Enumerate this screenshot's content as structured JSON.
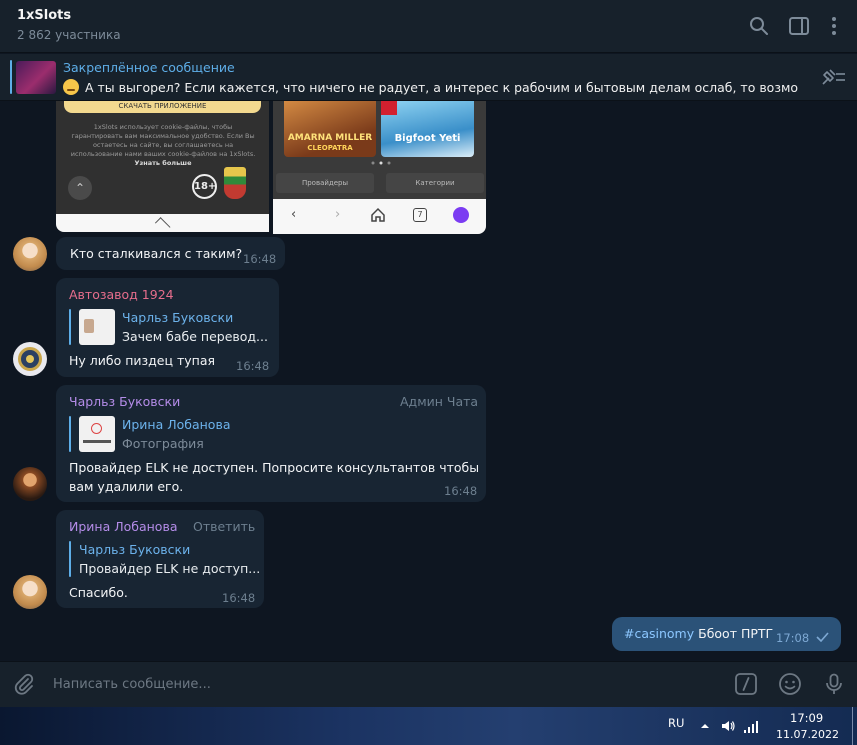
{
  "header": {
    "title": "1xSlots",
    "subtitle": "2 862 участника"
  },
  "pinned": {
    "title": "Закреплённое сообщение",
    "text": "А ты выгорел?   Если кажется, что ничего не радует, а интерес к рабочим и бытовым делам ослаб, то возможно ..."
  },
  "screenshots": {
    "left": {
      "download_label": "СКАЧАТЬ ПРИЛОЖЕНИЕ",
      "cookie_text": "1xSlots использует cookie-файлы, чтобы гарантировать вам максимальное удобство. Если Вы остаетесь на сайте, вы соглашаетесь на использование нами ваших cookie-файлов на 1xSlots.",
      "cookie_link": "Узнать больше",
      "age_label": "18+"
    },
    "right": {
      "tile1_label": "AMARNA MILLER",
      "tile1_sub": "CLEOPATRA",
      "tile2_label": "Bigfoot Yeti",
      "providers_label": "Провайдеры",
      "categories_label": "Категории",
      "tabs_count": "7"
    }
  },
  "messages": [
    {
      "text": "Кто  сталкивался с  таким?",
      "time": "16:48"
    },
    {
      "sender": "Автозавод 1924",
      "reply_name": "Чарльз Буковски",
      "reply_text": "Зачем бабе перевод...",
      "text": "Ну либо пиздец тупая",
      "time": "16:48"
    },
    {
      "sender": "Чарльз Буковски",
      "badge": "Админ Чата",
      "reply_name": "Ирина Лобанова",
      "reply_text": "Фотография",
      "text_line1": "Провайдер ELK не доступен. Попросите консультантов чтобы",
      "text_line2": "вам удалили его.",
      "time": "16:48"
    },
    {
      "sender": "Ирина Лобанова",
      "reply_action": "Ответить",
      "reply_name": "Чарльз Буковски",
      "reply_text": "Провайдер ELK не доступ...",
      "text": "Спасибо.",
      "time": "16:48"
    },
    {
      "hashtag": "#casinomy",
      "text": "Ббоот ПРТГ",
      "time": "17:08"
    }
  ],
  "composer": {
    "placeholder": "Написать сообщение..."
  },
  "taskbar": {
    "lang": "RU",
    "time": "17:09",
    "date": "11.07.2022"
  },
  "colors": {
    "background": "#0e1621",
    "panel": "#17212b",
    "bubble": "#182533",
    "own_bubble": "#2b5278",
    "accent": "#5eaee8",
    "sender_auto": "#e56d8c",
    "sender_purple": "#b48ce8"
  }
}
